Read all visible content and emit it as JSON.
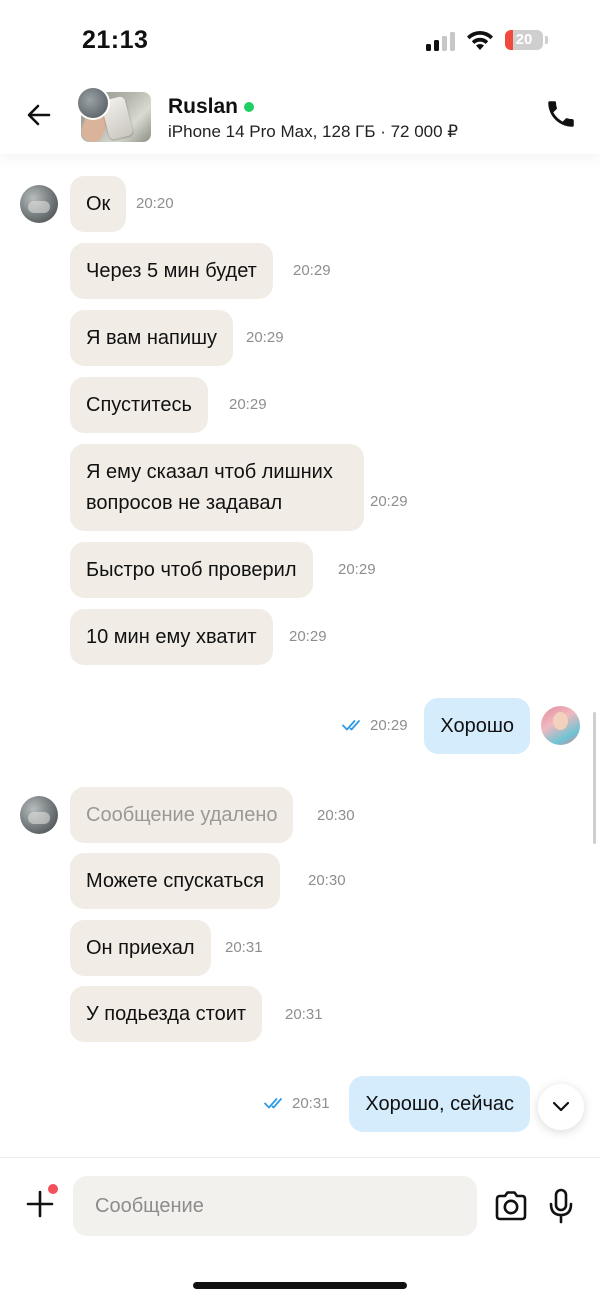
{
  "status_bar": {
    "time": "21:13",
    "battery_level": "20",
    "battery_percent": 20,
    "battery_color": "#ef4a3c",
    "icons": [
      "signal-icon",
      "wifi-icon",
      "battery-icon"
    ]
  },
  "header": {
    "back_icon": "arrow-left-icon",
    "contact_name": "Ruslan",
    "online": true,
    "listing": "iPhone 14 Pro Max, 128 ГБ · 72 000 ₽",
    "call_icon": "phone-icon"
  },
  "messages": [
    {
      "direction": "in",
      "text": "Ок",
      "time": "20:20"
    },
    {
      "direction": "in",
      "text": "Через 5 мин будет",
      "time": "20:29"
    },
    {
      "direction": "in",
      "text": "Я вам напишу",
      "time": "20:29"
    },
    {
      "direction": "in",
      "text": "Спуститесь",
      "time": "20:29"
    },
    {
      "direction": "in",
      "text": "Я ему сказал чтоб лишних вопросов не задавал",
      "time": "20:29"
    },
    {
      "direction": "in",
      "text": "Быстро чтоб проверил",
      "time": "20:29"
    },
    {
      "direction": "in",
      "text": "10 мин ему хватит",
      "time": "20:29"
    },
    {
      "direction": "out",
      "text": "Хорошо",
      "time": "20:29",
      "status": "read"
    },
    {
      "direction": "in",
      "text": "Сообщение удалено",
      "time": "20:30",
      "deleted": true
    },
    {
      "direction": "in",
      "text": "Можете спускаться",
      "time": "20:30"
    },
    {
      "direction": "in",
      "text": "Он приехал",
      "time": "20:31"
    },
    {
      "direction": "in",
      "text": "У подьезда стоит",
      "time": "20:31"
    },
    {
      "direction": "out",
      "text": "Хорошо, сейчас",
      "time": "20:31",
      "status": "read"
    }
  ],
  "input": {
    "placeholder": "Сообщение",
    "value": "",
    "icons": [
      "plus-icon",
      "camera-icon",
      "microphone-icon"
    ]
  },
  "colors": {
    "incoming_bubble": "#f1ede6",
    "outgoing_bubble": "#d5ecfd",
    "online_dot": "#1fcf62",
    "read_ticks": "#2f9ae6",
    "notification_dot": "#f1505c"
  }
}
